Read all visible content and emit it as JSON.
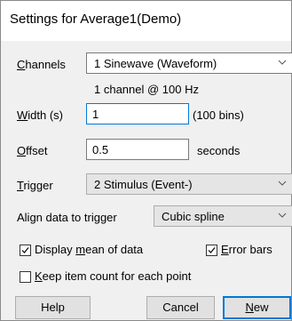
{
  "title": "Settings for Average1(Demo)",
  "channels": {
    "label_pre": "",
    "label_u": "C",
    "label_post": "hannels",
    "value": "1 Sinewave (Waveform)",
    "info": "1 channel @ 100 Hz"
  },
  "width": {
    "label_u": "W",
    "label_post": "idth (s)",
    "value": "1",
    "suffix": "(100 bins)"
  },
  "offset": {
    "label_u": "O",
    "label_post": "ffset",
    "value": "0.5",
    "suffix": "seconds"
  },
  "trigger": {
    "label_u": "T",
    "label_post": "rigger",
    "value": "2 Stimulus (Event-)"
  },
  "align": {
    "label": "Align data to trigger",
    "value": "Cubic spline"
  },
  "display_mean": {
    "label_pre": "Display ",
    "label_u": "m",
    "label_post": "ean of data",
    "checked": true
  },
  "error_bars": {
    "label_u": "E",
    "label_post": "rror bars",
    "checked": true
  },
  "keep_count": {
    "label_u": "K",
    "label_post": "eep item count for each point",
    "checked": false
  },
  "buttons": {
    "help": "Help",
    "cancel": "Cancel",
    "new_u": "N",
    "new_post": "ew"
  },
  "colors": {
    "accent": "#0078d7",
    "dialog_bg": "#f0f0f0"
  }
}
